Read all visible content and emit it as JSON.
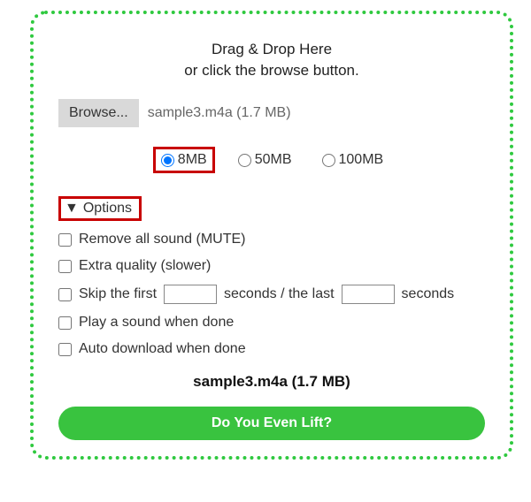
{
  "drop": {
    "title": "Drag & Drop Here",
    "subtitle": "or click the browse button."
  },
  "file": {
    "browse_label": "Browse...",
    "selected": "sample3.m4a (1.7 MB)"
  },
  "sizes": {
    "opt1": "8MB",
    "opt2": "50MB",
    "opt3": "100MB",
    "selected": "8MB"
  },
  "options": {
    "toggle_label": "Options",
    "mute": "Remove all sound (MUTE)",
    "extra_quality": "Extra quality (slower)",
    "skip_prefix": "Skip the first",
    "skip_mid": "seconds / the last",
    "skip_suffix": "seconds",
    "play_sound": "Play a sound when done",
    "auto_download": "Auto download when done"
  },
  "summary": "sample3.m4a (1.7 MB)",
  "action": {
    "label": "Do You Even Lift?"
  }
}
